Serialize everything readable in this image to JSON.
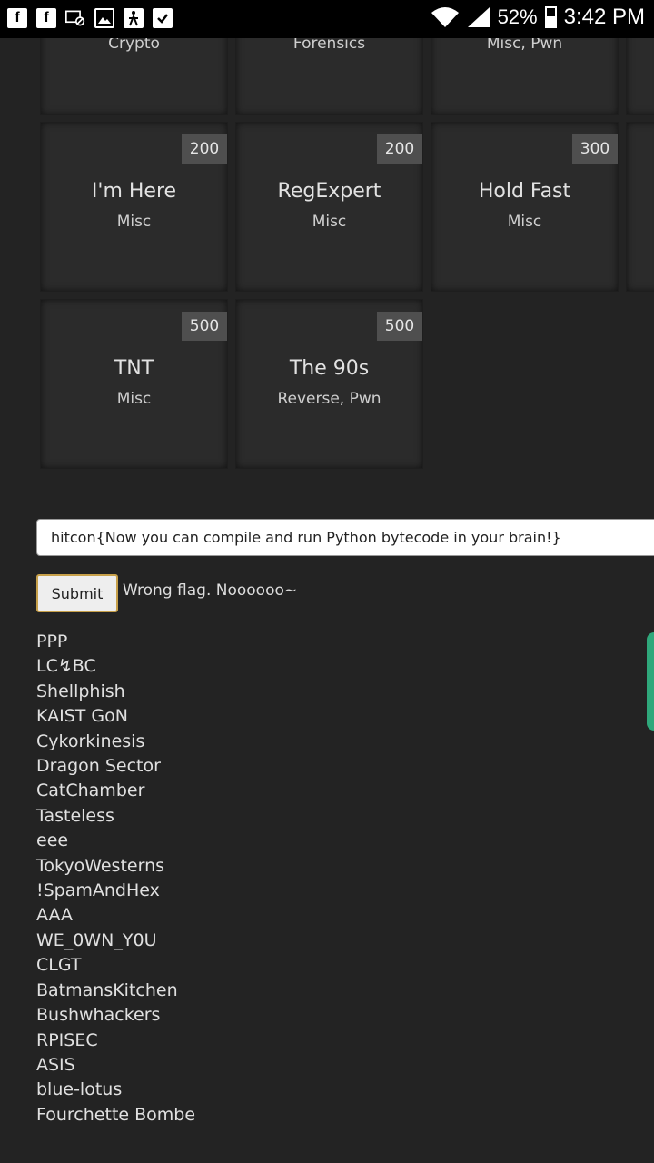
{
  "status_bar": {
    "battery": "52%",
    "time": "3:42 PM",
    "icons": [
      "facebook-icon",
      "facebook-icon",
      "screen-icon",
      "image-icon",
      "accessibility-icon",
      "clipboard-check-icon",
      "wifi-icon",
      "signal-icon",
      "battery-icon"
    ]
  },
  "challenges": [
    {
      "title": "",
      "category": "Crypto",
      "points": ""
    },
    {
      "title": "",
      "category": "Forensics",
      "points": ""
    },
    {
      "title": "",
      "category": "Misc, Pwn",
      "points": ""
    },
    {
      "title": "I'm Here",
      "category": "Misc",
      "points": "200"
    },
    {
      "title": "RegExpert",
      "category": "Misc",
      "points": "200"
    },
    {
      "title": "Hold Fast",
      "category": "Misc",
      "points": "300"
    },
    {
      "title": "TNT",
      "category": "Misc",
      "points": "500"
    },
    {
      "title": "The 90s",
      "category": "Reverse, Pwn",
      "points": "500"
    }
  ],
  "flag_form": {
    "input_value": "hitcon{Now you can compile and run Python bytecode in your brain!}",
    "submit_label": "Submit",
    "result_message": "Wrong flag. Noooooo~"
  },
  "teams": [
    "PPP",
    "LC↯BC",
    "Shellphish",
    "KAIST GoN",
    "Cykorkinesis",
    "Dragon Sector",
    "CatChamber",
    "Tasteless",
    "eee",
    "TokyoWesterns",
    "!SpamAndHex",
    "AAA",
    "WE_0WN_Y0U",
    "CLGT",
    "BatmansKitchen",
    "Bushwhackers",
    "RPISEC",
    "ASIS",
    "blue-lotus",
    "Fourchette Bombe"
  ],
  "colors": {
    "background": "#232323",
    "card": "#2b2b2b",
    "points_badge": "#4f4f4f",
    "submit_border": "#c7a04a",
    "side_tab": "#2fa87b"
  }
}
